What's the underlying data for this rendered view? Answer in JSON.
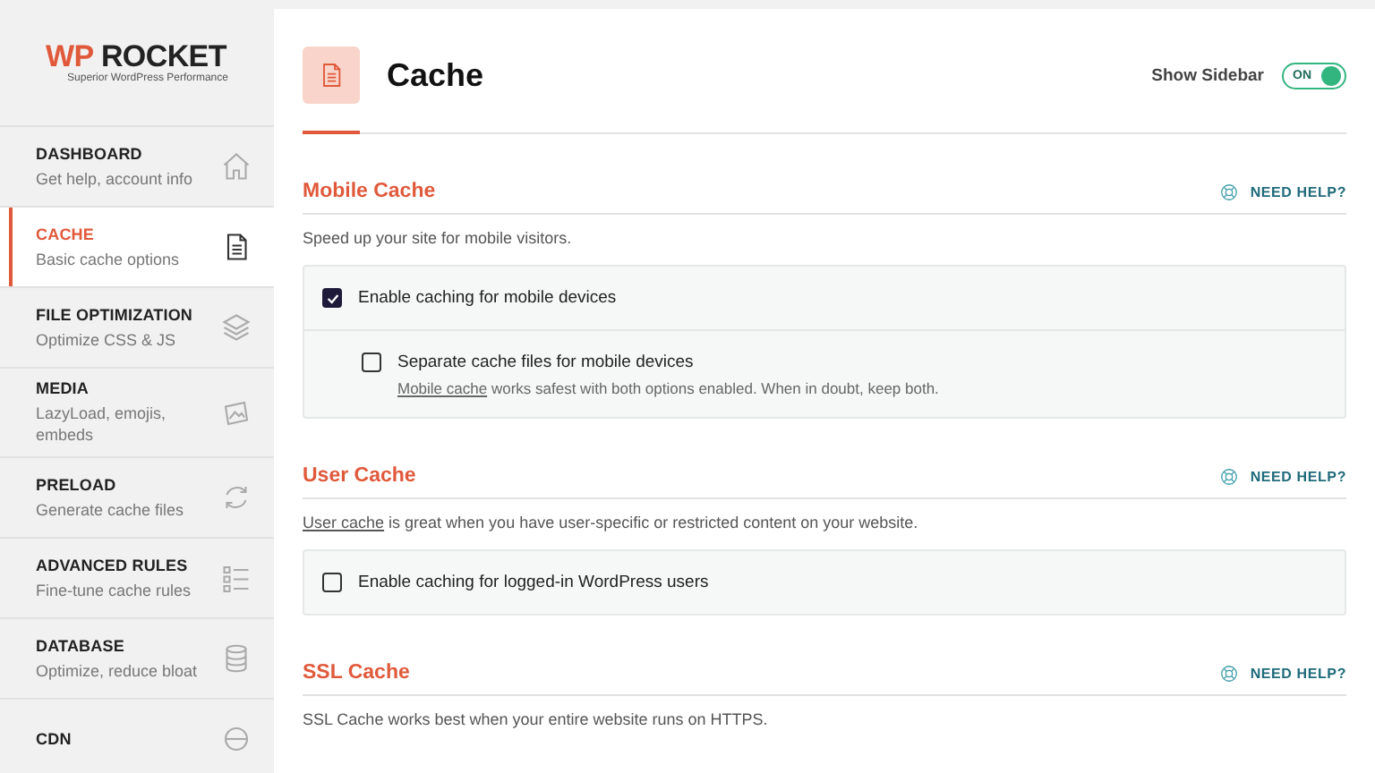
{
  "logo": {
    "brand_wp": "WP",
    "brand_rocket": "ROCKET",
    "tagline": "Superior WordPress Performance"
  },
  "sidebar": {
    "items": [
      {
        "title": "DASHBOARD",
        "description": "Get help, account info",
        "selected": false
      },
      {
        "title": "CACHE",
        "description": "Basic cache options",
        "selected": true
      },
      {
        "title": "FILE OPTIMIZATION",
        "description": "Optimize CSS & JS",
        "selected": false
      },
      {
        "title": "MEDIA",
        "description": "LazyLoad, emojis, embeds",
        "selected": false
      },
      {
        "title": "PRELOAD",
        "description": "Generate cache files",
        "selected": false
      },
      {
        "title": "ADVANCED RULES",
        "description": "Fine-tune cache rules",
        "selected": false
      },
      {
        "title": "DATABASE",
        "description": "Optimize, reduce bloat",
        "selected": false
      },
      {
        "title": "CDN",
        "selected": false
      }
    ]
  },
  "header": {
    "title": "Cache",
    "sidebar_toggle": {
      "label": "Show Sidebar",
      "state_text": "ON",
      "on": true
    }
  },
  "sections": [
    {
      "title": "Mobile Cache",
      "help": "NEED HELP?",
      "description": {
        "text": "Speed up your site for mobile visitors."
      },
      "options": [
        {
          "label": "Enable caching for mobile devices",
          "checked": true,
          "nested": false
        },
        {
          "label": "Separate cache files for mobile devices",
          "checked": false,
          "nested": true,
          "note": {
            "link": "Mobile cache",
            "text": " works safest with both options enabled. When in doubt, keep both."
          }
        }
      ]
    },
    {
      "title": "User Cache",
      "help": "NEED HELP?",
      "description": {
        "link": "User cache",
        "text": " is great when you have user-specific or restricted content on your website."
      },
      "options": [
        {
          "label": "Enable caching for logged-in WordPress users",
          "checked": false,
          "nested": false
        }
      ]
    },
    {
      "title": "SSL Cache",
      "help": "NEED HELP?",
      "description": {
        "text": "SSL Cache works best when your entire website runs on HTTPS."
      }
    }
  ]
}
